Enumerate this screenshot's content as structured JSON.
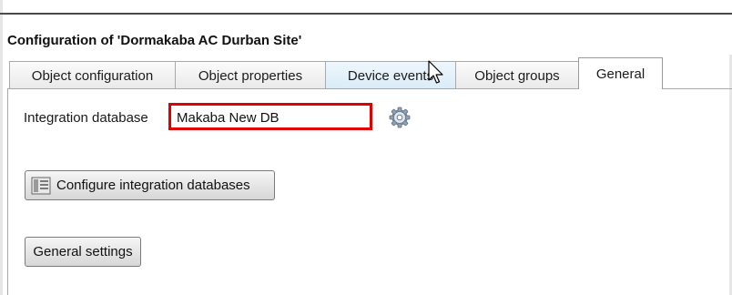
{
  "window": {
    "title": "Configuration of 'Dormakaba AC Durban Site'"
  },
  "tabs": [
    {
      "label": "Object configuration",
      "state": "normal"
    },
    {
      "label": "Object properties",
      "state": "normal"
    },
    {
      "label": "Device events",
      "state": "hover"
    },
    {
      "label": "Object groups",
      "state": "normal"
    },
    {
      "label": "General",
      "state": "active"
    }
  ],
  "general": {
    "integration_database_label": "Integration database",
    "integration_database_value": "Makaba New DB",
    "settings_icon": "gear-icon",
    "configure_button_label": "Configure integration databases",
    "configure_button_icon": "database-list-icon",
    "general_settings_label": "General settings"
  },
  "colors": {
    "highlight_box": "#e00000",
    "hover_tab": "#d9ecf8"
  }
}
